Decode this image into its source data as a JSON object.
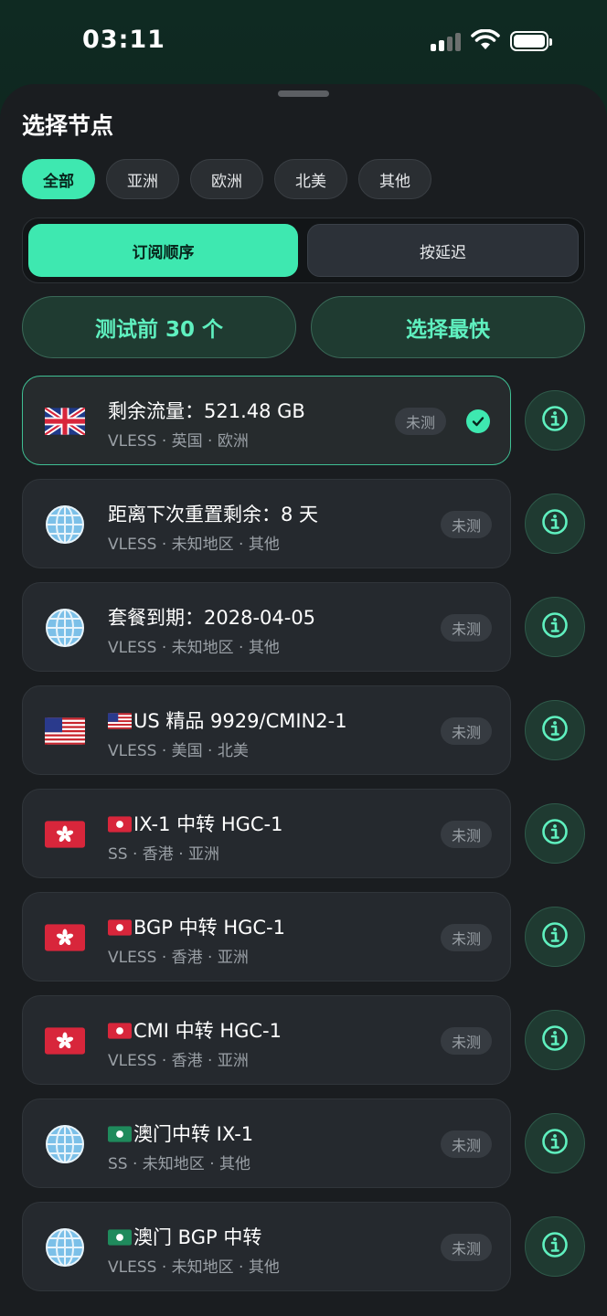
{
  "status_bar": {
    "time": "03:11"
  },
  "sheet": {
    "title": "选择节点",
    "filters": [
      {
        "label": "全部",
        "active": true
      },
      {
        "label": "亚洲",
        "active": false
      },
      {
        "label": "欧洲",
        "active": false
      },
      {
        "label": "北美",
        "active": false
      },
      {
        "label": "其他",
        "active": false
      }
    ],
    "sort": {
      "order_label": "订阅顺序",
      "latency_label": "按延迟"
    },
    "actions": {
      "test_label": "测试前 30 个",
      "fastest_label": "选择最快"
    },
    "nodes": [
      {
        "flag": "uk-flag",
        "prefix": "",
        "name": "剩余流量：521.48 GB",
        "meta": "VLESS · 英国 · 欧洲",
        "status": "未测",
        "selected": true
      },
      {
        "flag": "globe",
        "prefix": "",
        "name": "距离下次重置剩余：8 天",
        "meta": "VLESS · 未知地区 · 其他",
        "status": "未测",
        "selected": false
      },
      {
        "flag": "globe",
        "prefix": "",
        "name": "套餐到期：2028-04-05",
        "meta": "VLESS · 未知地区 · 其他",
        "status": "未测",
        "selected": false
      },
      {
        "flag": "us-flag",
        "prefix": "us-flag",
        "name": "US 精品 9929/CMIN2-1",
        "meta": "VLESS · 美国 · 北美",
        "status": "未测",
        "selected": false
      },
      {
        "flag": "hk-flag",
        "prefix": "hk-flag",
        "name": "IX-1 中转 HGC-1",
        "meta": "SS · 香港 · 亚洲",
        "status": "未测",
        "selected": false
      },
      {
        "flag": "hk-flag",
        "prefix": "hk-flag",
        "name": "BGP 中转 HGC-1",
        "meta": "VLESS · 香港 · 亚洲",
        "status": "未测",
        "selected": false
      },
      {
        "flag": "hk-flag",
        "prefix": "hk-flag",
        "name": "CMI 中转 HGC-1",
        "meta": "VLESS · 香港 · 亚洲",
        "status": "未测",
        "selected": false
      },
      {
        "flag": "globe",
        "prefix": "mo-flag",
        "name": "澳门中转 IX-1",
        "meta": "SS · 未知地区 · 其他",
        "status": "未测",
        "selected": false
      },
      {
        "flag": "globe",
        "prefix": "mo-flag",
        "name": "澳门 BGP 中转",
        "meta": "VLESS · 未知地区 · 其他",
        "status": "未测",
        "selected": false
      }
    ]
  },
  "colors": {
    "accent": "#3ee8b0",
    "sheet_bg": "#1a1d20",
    "card_bg": "#25292e"
  }
}
